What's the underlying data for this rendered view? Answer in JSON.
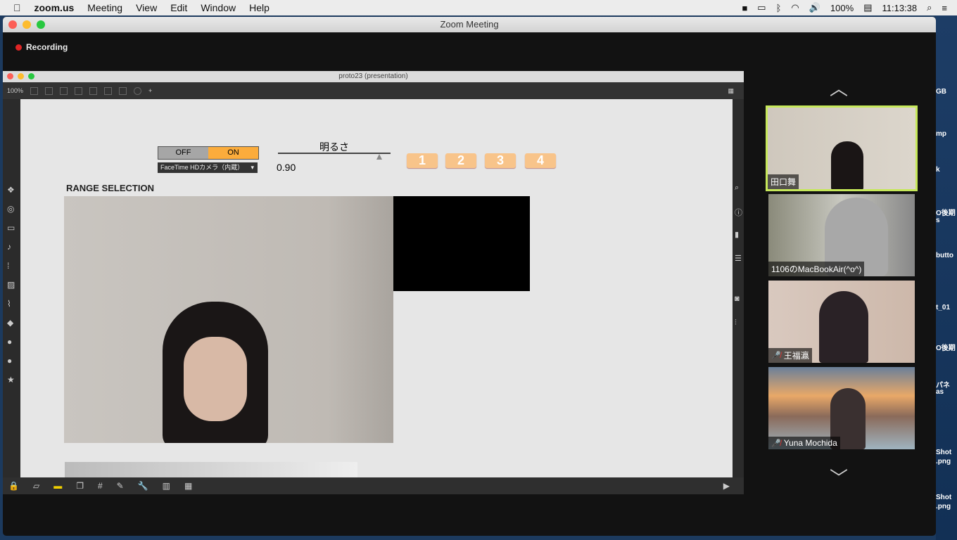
{
  "menubar": {
    "app": "zoom.us",
    "items": [
      "Meeting",
      "View",
      "Edit",
      "Window",
      "Help"
    ],
    "battery": "100%",
    "time": "11:13:38"
  },
  "zoom_window": {
    "title": "Zoom Meeting",
    "recording": "Recording"
  },
  "max_window": {
    "title": "proto23 (presentation)",
    "zoom": "100%"
  },
  "patch": {
    "off": "OFF",
    "on": "ON",
    "camera": "FaceTime HDカメラ（内蔵）",
    "slider_label": "明るさ",
    "slider_value": "0.90",
    "slider_fraction": 0.9,
    "presets": [
      "1",
      "2",
      "3",
      "4"
    ],
    "range_title": "RANGE SELECTION"
  },
  "participants": [
    {
      "name": "田口舞",
      "active": true,
      "muted": false
    },
    {
      "name": "1106のMacBookAir(^o^)",
      "muted": false
    },
    {
      "name": "王福瀛",
      "muted": true
    },
    {
      "name": "Yuna Mochida",
      "muted": true
    }
  ],
  "desktop_labels": [
    "GB",
    "mp",
    "k",
    "O後期",
    "s",
    "butto",
    "t_01",
    "O後期",
    "パネ",
    "as",
    "Shot",
    ".png",
    "Shot",
    ".png"
  ]
}
